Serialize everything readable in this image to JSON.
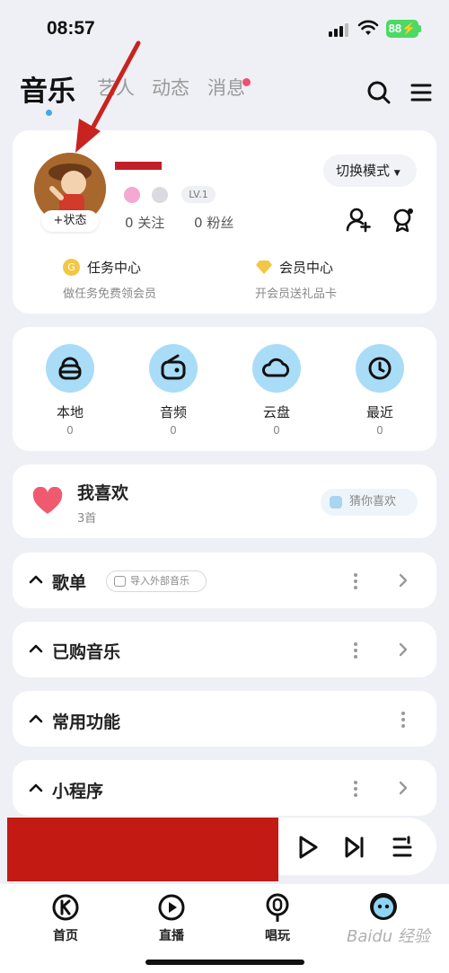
{
  "status_bar": {
    "time": "08:57",
    "battery": "88"
  },
  "nav": {
    "tabs": [
      {
        "label": "音乐",
        "active": true
      },
      {
        "label": "艺人",
        "active": false
      },
      {
        "label": "动态",
        "active": false
      },
      {
        "label": "消息",
        "active": false,
        "has_dot": true
      }
    ],
    "right_icons": [
      "search-icon",
      "menu-icon"
    ]
  },
  "profile": {
    "status_label": "+状态",
    "level": "LV.1",
    "follow_count": "0",
    "follow_label": "关注",
    "fans_count": "0",
    "fans_label": "粉丝",
    "mode_label": "切换模式",
    "actions": [
      "add-friend-icon",
      "badge-icon"
    ],
    "task_center": {
      "title": "任务中心",
      "subtitle": "做任务免费领会员"
    },
    "vip_center": {
      "title": "会员中心",
      "subtitle": "开会员送礼品卡"
    }
  },
  "quick_access": [
    {
      "label": "本地",
      "count": "0",
      "icon": "bag-icon"
    },
    {
      "label": "音频",
      "count": "0",
      "icon": "radio-icon"
    },
    {
      "label": "云盘",
      "count": "0",
      "icon": "cloud-icon"
    },
    {
      "label": "最近",
      "count": "0",
      "icon": "clock-icon"
    }
  ],
  "liked": {
    "title": "我喜欢",
    "count": "3首",
    "guess_label": "猜你喜欢"
  },
  "sections": {
    "playlist": {
      "title": "歌单",
      "import_label": "导入外部音乐"
    },
    "purchased": {
      "title": "已购音乐"
    },
    "common": {
      "title": "常用功能"
    },
    "mini": {
      "title": "小程序"
    }
  },
  "tabbar": [
    {
      "label": "首页",
      "icon": "k-logo-icon"
    },
    {
      "label": "直播",
      "icon": "live-play-icon"
    },
    {
      "label": "唱玩",
      "icon": "mic-icon"
    },
    {
      "label": "",
      "icon": "mascot-icon"
    }
  ],
  "watermark": "Baidu 经验",
  "colors": {
    "accent_blue": "#a9dcf7",
    "heart": "#f05a6e",
    "redaction": "#c31a14",
    "annotation": "#c8231e"
  }
}
